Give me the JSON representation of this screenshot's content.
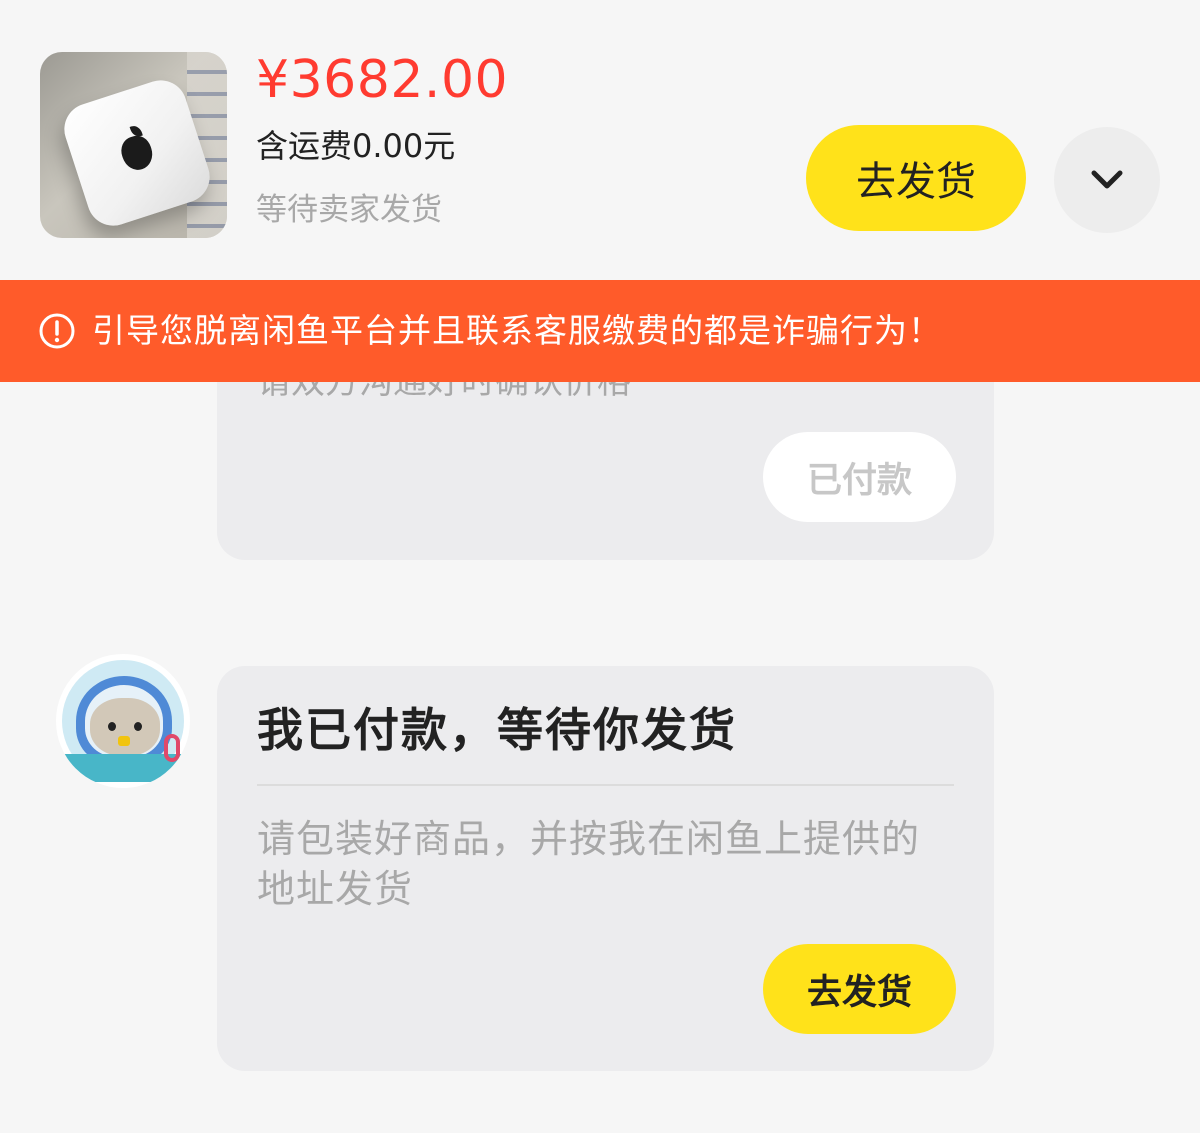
{
  "product": {
    "image_icon": "mac-mini-product-photo",
    "price": "¥3682.00",
    "shipping_fee": "含运费0.00元",
    "status": "等待卖家发货",
    "ship_button_label": "去发货",
    "expand_icon": "chevron-down-icon"
  },
  "warning": {
    "icon": "exclamation-circle-icon",
    "text": "引导您脱离闲鱼平台并且联系客服缴费的都是诈骗行为！"
  },
  "chat": {
    "prev_message": {
      "partial_text": "请双方沟通好时确认价格",
      "button_label": "已付款"
    },
    "buyer_avatar_icon": "seal-astronaut-avatar",
    "message": {
      "title": "我已付款，等待你发货",
      "body": "请包装好商品，并按我在闲鱼上提供的地址发货",
      "button_label": "去发货"
    }
  },
  "colors": {
    "price_red": "#ff3b30",
    "accent_yellow": "#ffe21a",
    "warning_orange": "#ff5b2a",
    "bubble_gray": "#ececee"
  }
}
